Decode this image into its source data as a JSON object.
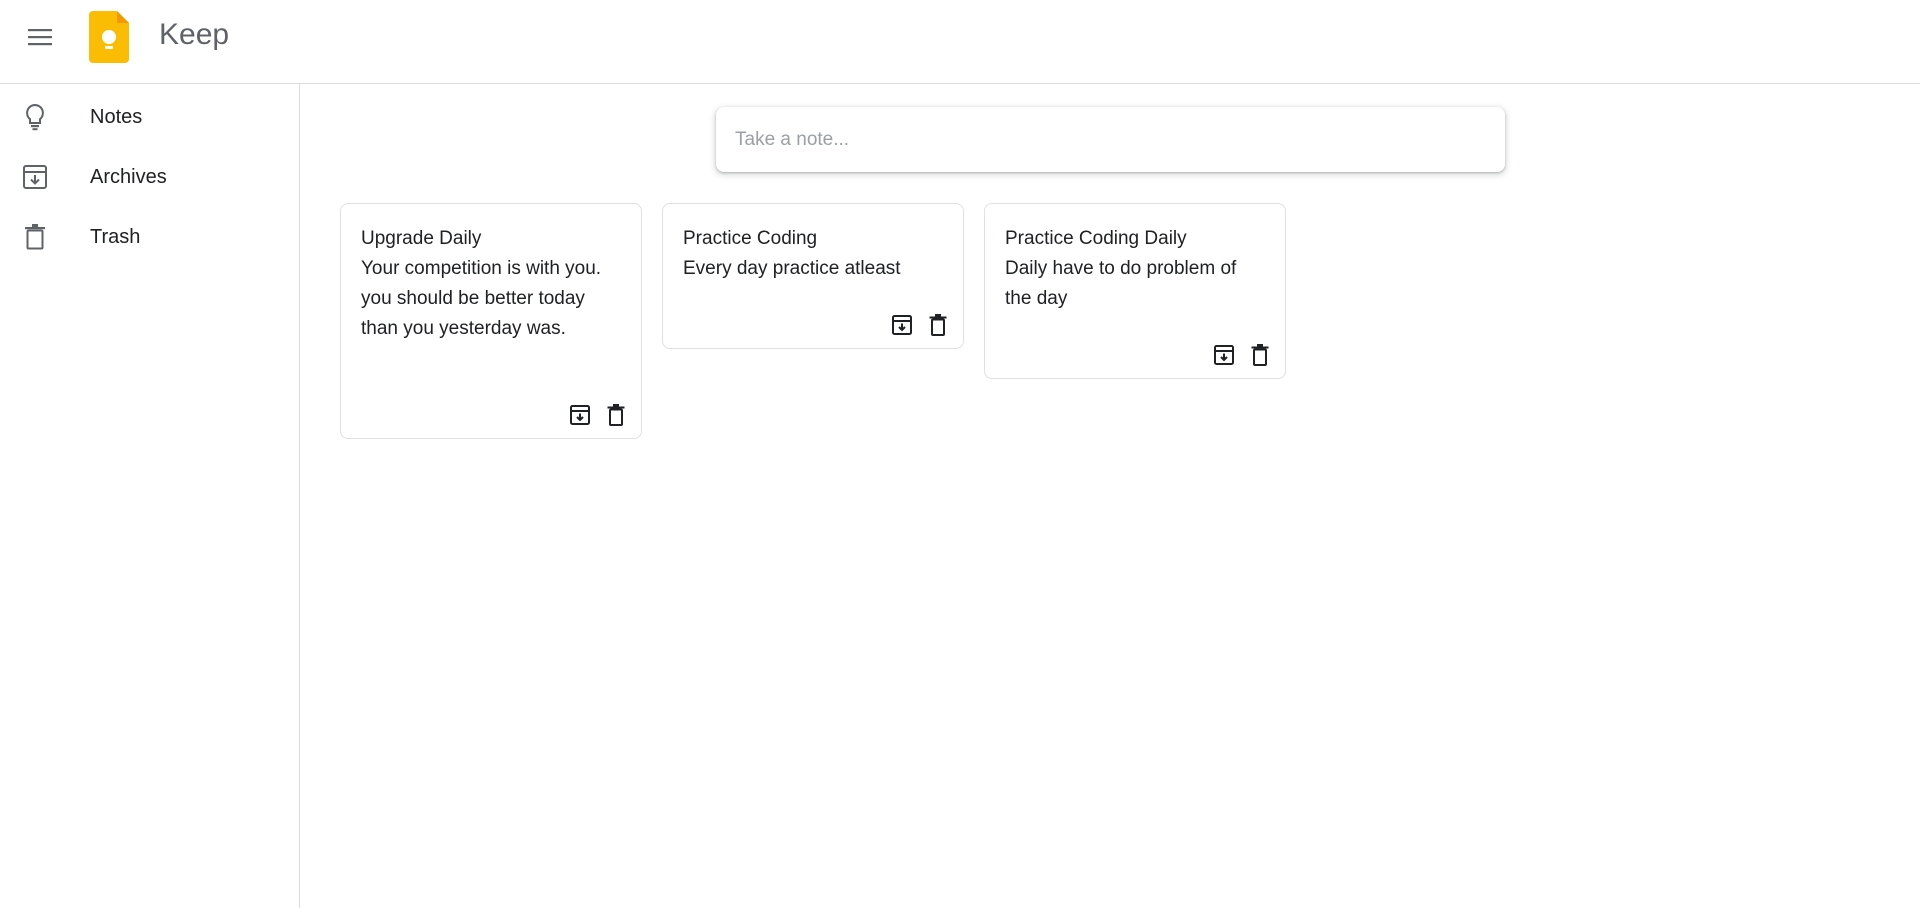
{
  "header": {
    "menu_icon": "hamburger-menu-icon",
    "logo_icon": "keep-logo-icon",
    "brand": "Keep",
    "brand_color": "#5f6368",
    "logo_color": "#fbbc04"
  },
  "sidebar": {
    "items": [
      {
        "label": "Notes",
        "icon": "lightbulb-icon"
      },
      {
        "label": "Archives",
        "icon": "archive-icon"
      },
      {
        "label": "Trash",
        "icon": "trash-icon"
      }
    ]
  },
  "note_input": {
    "placeholder": "Take a note..."
  },
  "notes": [
    {
      "title": "Upgrade Daily",
      "content": "Your competition is with you. you should be better today than you yesterday was."
    },
    {
      "title": "Practice Coding",
      "content": "Every day practice atleast"
    },
    {
      "title": "Practice Coding Daily",
      "content": "Daily have to do problem of the day"
    }
  ]
}
